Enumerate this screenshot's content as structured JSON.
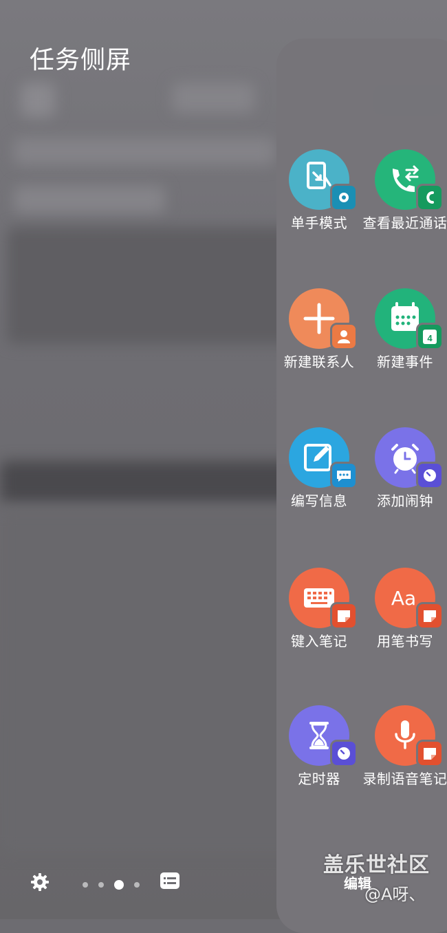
{
  "screen": {
    "title": "任务侧屏"
  },
  "tiles": [
    {
      "label": "单手模式",
      "color": "#4bb2c8",
      "badge_color": "#1a8fb4",
      "icon": "one-hand-icon",
      "badge_icon": "gear-badge-icon"
    },
    {
      "label": "查看最近通话",
      "color": "#25b57a",
      "badge_color": "#159a5e",
      "icon": "phone-swap-icon",
      "badge_icon": "call-log-badge-icon"
    },
    {
      "label": "新建联系人",
      "color": "#ef8a5a",
      "badge_color": "#ec7a44",
      "icon": "plus-icon",
      "badge_icon": "person-badge-icon"
    },
    {
      "label": "新建事件",
      "color": "#22b37b",
      "badge_color": "#159a5e",
      "icon": "calendar-icon",
      "badge_icon": "calendar-badge-icon"
    },
    {
      "label": "编写信息",
      "color": "#2ba6e0",
      "badge_color": "#1e8fd0",
      "icon": "compose-icon",
      "badge_icon": "message-badge-icon"
    },
    {
      "label": "添加闹钟",
      "color": "#7a72e8",
      "badge_color": "#5a4fd6",
      "icon": "alarm-clock-icon",
      "badge_icon": "clock-badge-icon"
    },
    {
      "label": "键入笔记",
      "color": "#f06a47",
      "badge_color": "#e2502f",
      "icon": "keyboard-icon",
      "badge_icon": "note-badge-icon"
    },
    {
      "label": "用笔书写",
      "color": "#f06a47",
      "badge_color": "#e2502f",
      "icon": "handwriting-icon",
      "badge_icon": "note-badge-icon"
    },
    {
      "label": "定时器",
      "color": "#7a72e8",
      "badge_color": "#5a4fd6",
      "icon": "hourglass-icon",
      "badge_icon": "clock-badge-icon"
    },
    {
      "label": "录制语音笔记",
      "color": "#f06a47",
      "badge_color": "#e2502f",
      "icon": "microphone-icon",
      "badge_icon": "note-badge-icon"
    }
  ],
  "calendar_badge_day": "4",
  "bottom": {
    "edit_label": "编辑",
    "page_count": 4,
    "active_page": 3
  },
  "watermark": {
    "text": "盖乐世社区",
    "handle": "@A呀、"
  }
}
